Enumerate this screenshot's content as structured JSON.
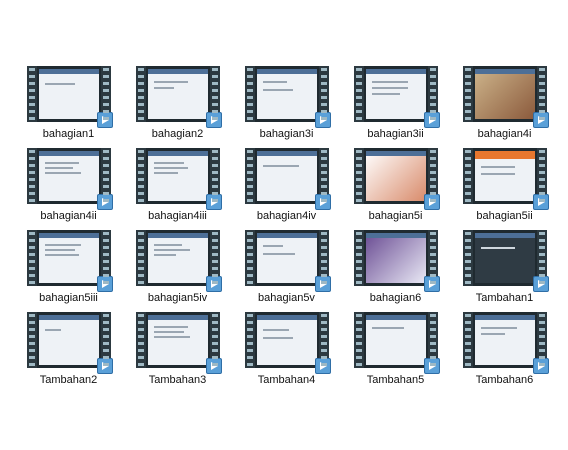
{
  "items": [
    {
      "label": "bahagian1"
    },
    {
      "label": "bahagian2"
    },
    {
      "label": "bahagian3i"
    },
    {
      "label": "bahagian3ii"
    },
    {
      "label": "bahagian4i"
    },
    {
      "label": "bahagian4ii"
    },
    {
      "label": "bahagian4iii"
    },
    {
      "label": "bahagian4iv"
    },
    {
      "label": "bahagian5i"
    },
    {
      "label": "bahagian5ii"
    },
    {
      "label": "bahagian5iii"
    },
    {
      "label": "bahagian5iv"
    },
    {
      "label": "bahagian5v"
    },
    {
      "label": "bahagian6"
    },
    {
      "label": "Tambahan1"
    },
    {
      "label": "Tambahan2"
    },
    {
      "label": "Tambahan3"
    },
    {
      "label": "Tambahan4"
    },
    {
      "label": "Tambahan5"
    },
    {
      "label": "Tambahan6"
    }
  ]
}
